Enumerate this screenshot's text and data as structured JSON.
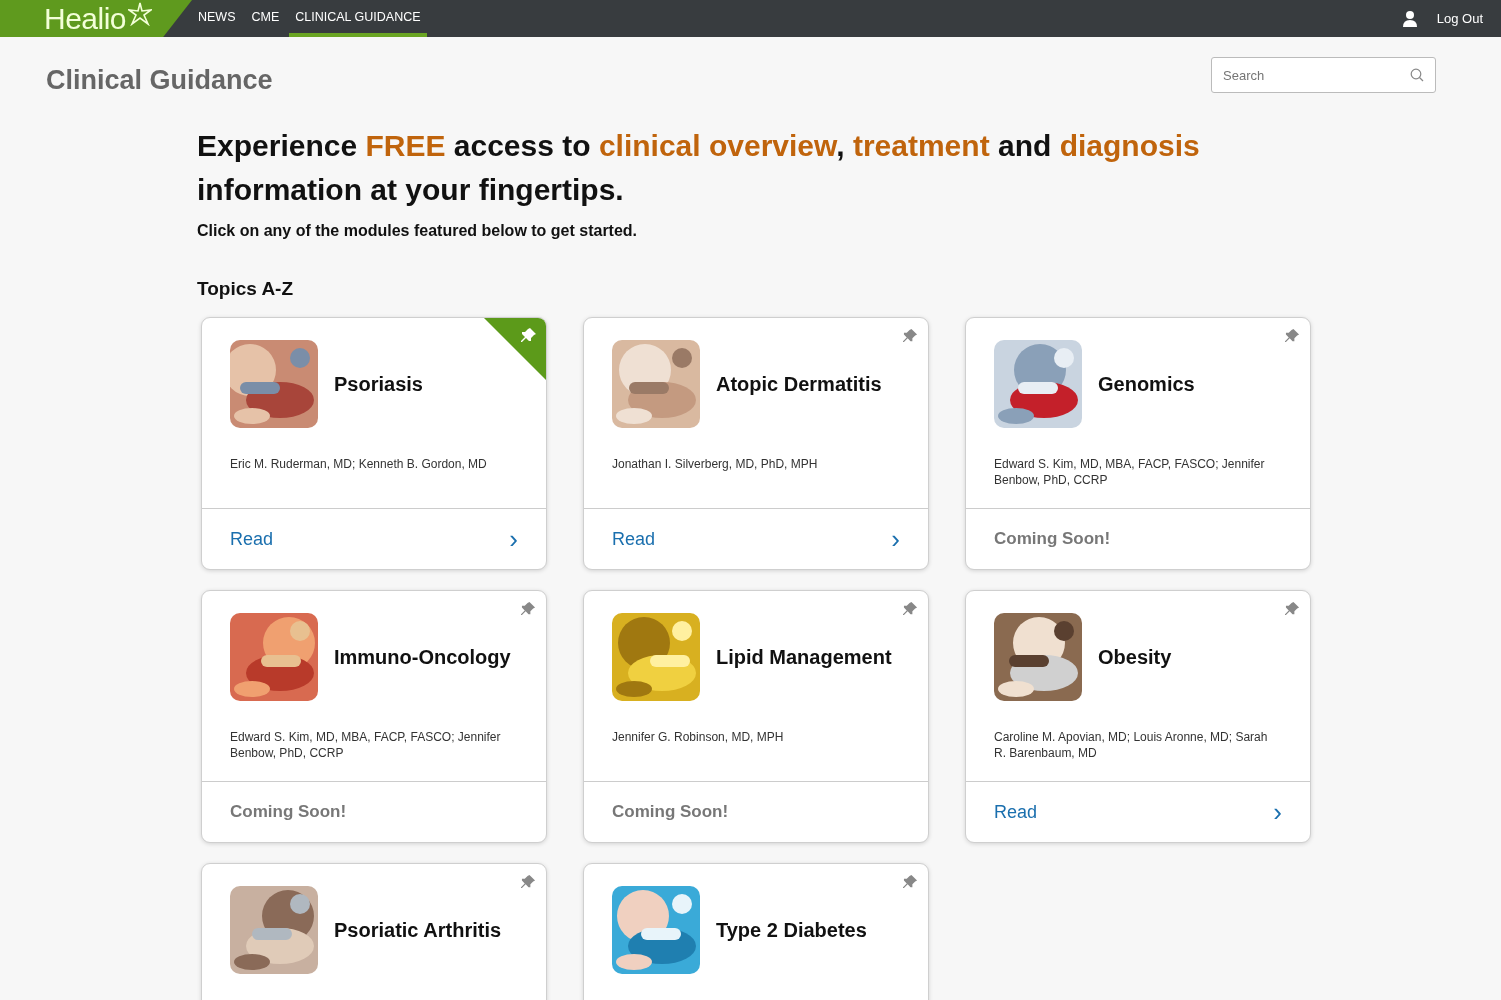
{
  "topbar": {
    "logo": "Healio",
    "nav": [
      {
        "label": "NEWS",
        "selected": false
      },
      {
        "label": "CME",
        "selected": false
      },
      {
        "label": "CLINICAL GUIDANCE",
        "selected": true
      }
    ],
    "logout": "Log Out"
  },
  "page_title": "Clinical Guidance",
  "search": {
    "placeholder": "Search"
  },
  "headline": [
    [
      {
        "text": "Experience ",
        "highlight": false
      },
      {
        "text": "FREE",
        "highlight": true
      },
      {
        "text": " access to ",
        "highlight": false
      },
      {
        "text": "clinical overview",
        "highlight": true
      },
      {
        "text": ", ",
        "highlight": false
      },
      {
        "text": "treatment",
        "highlight": true
      },
      {
        "text": " and ",
        "highlight": false
      },
      {
        "text": "diagnosis",
        "highlight": true
      }
    ],
    [
      {
        "text": "information at your fingertips.",
        "highlight": false
      }
    ]
  ],
  "subline": "Click on any of the modules featured below to get started.",
  "section_title": "Topics A-Z",
  "cards": [
    {
      "title": "Psoriasis",
      "pinned": true,
      "authors": "Eric M. Ruderman, MD; Kenneth B. Gordon, MD",
      "footer": {
        "kind": "read",
        "label": "Read",
        "arrow": "›"
      }
    },
    {
      "title": "Atopic Dermatitis",
      "pinned": false,
      "authors": "Jonathan I. Silverberg, MD, PhD, MPH",
      "footer": {
        "kind": "read",
        "label": "Read",
        "arrow": "›"
      }
    },
    {
      "title": "Genomics",
      "pinned": false,
      "authors": "Edward S. Kim, MD, MBA, FACP, FASCO; Jennifer Benbow, PhD, CCRP",
      "footer": {
        "kind": "soon",
        "label": "Coming Soon!"
      }
    },
    {
      "title": "Immuno-Oncology",
      "pinned": false,
      "authors": "Edward S. Kim, MD, MBA, FACP, FASCO; Jennifer Benbow, PhD, CCRP",
      "footer": {
        "kind": "soon",
        "label": "Coming Soon!"
      }
    },
    {
      "title": "Lipid Management",
      "pinned": false,
      "authors": "Jennifer G. Robinson, MD, MPH",
      "footer": {
        "kind": "soon",
        "label": "Coming Soon!"
      }
    },
    {
      "title": "Obesity",
      "pinned": false,
      "authors": "Caroline M. Apovian, MD; Louis Aronne, MD; Sarah R. Barenbaum, MD",
      "footer": {
        "kind": "read",
        "label": "Read",
        "arrow": "›"
      }
    },
    {
      "title": "Psoriatic Arthritis",
      "pinned": false
    },
    {
      "title": "Type 2 Diabetes",
      "pinned": false
    }
  ]
}
